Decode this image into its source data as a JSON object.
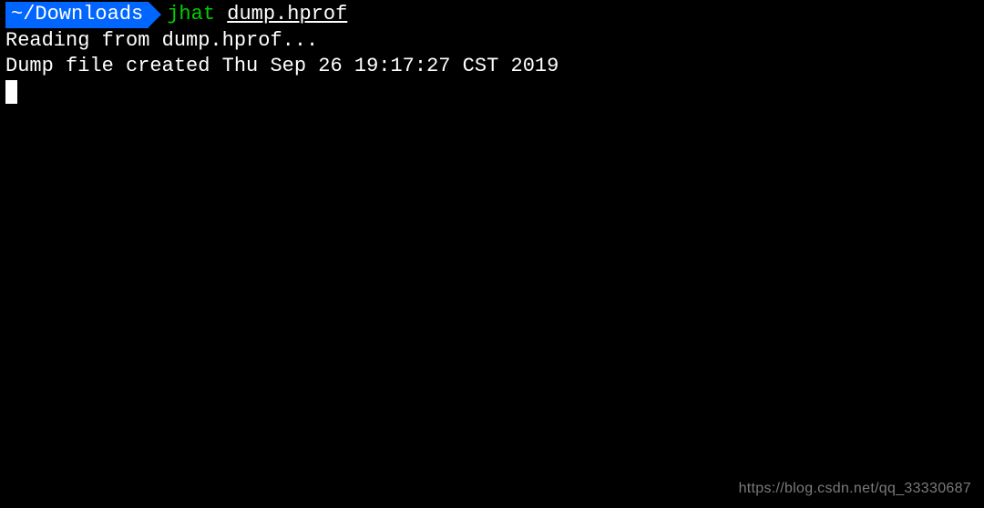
{
  "prompt": {
    "path": "~/Downloads",
    "command": "jhat",
    "argument": "dump.hprof"
  },
  "output": {
    "line1": "Reading from dump.hprof...",
    "line2": "Dump file created Thu Sep 26 19:17:27 CST 2019"
  },
  "watermark": "https://blog.csdn.net/qq_33330687"
}
